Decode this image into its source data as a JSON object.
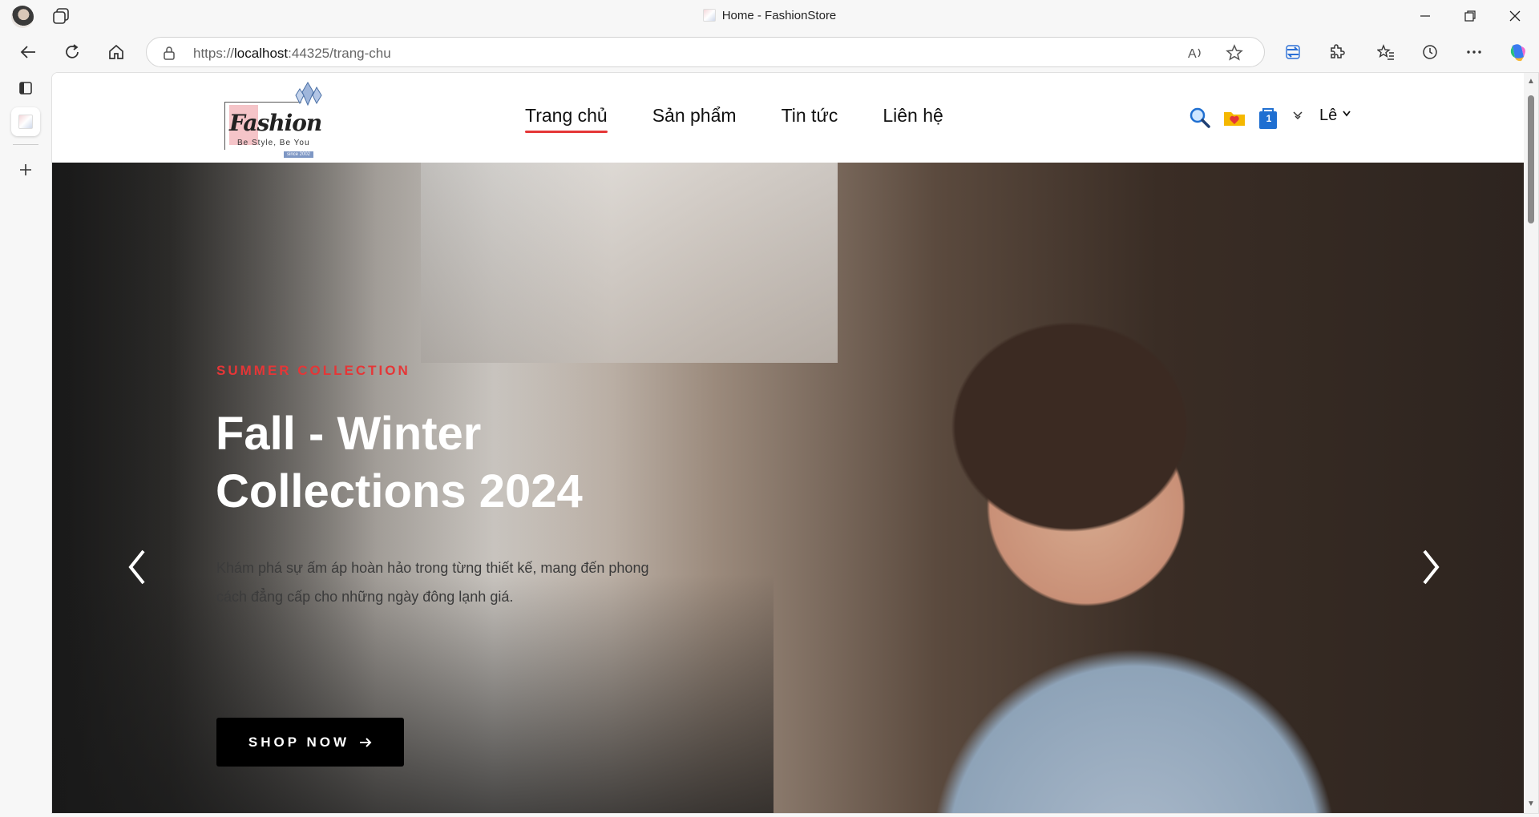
{
  "browser": {
    "window_title": "Home - FashionStore",
    "url_scheme": "https://",
    "url_host": "localhost",
    "url_rest": ":44325/trang-chu"
  },
  "site": {
    "logo": {
      "brand": "Fashion",
      "tagline": "Be Style, Be You",
      "since": "since 2002"
    },
    "nav": [
      {
        "label": "Trang chủ",
        "active": true
      },
      {
        "label": "Sản phẩm",
        "active": false
      },
      {
        "label": "Tin tức",
        "active": false
      },
      {
        "label": "Liên hệ",
        "active": false
      }
    ],
    "cart_count": "1",
    "user_name": "Lê"
  },
  "hero": {
    "kicker": "SUMMER COLLECTION",
    "title": "Fall - Winter Collections 2024",
    "description": "Khám phá sự ấm áp hoàn hảo trong từng thiết kế, mang đến phong cách đẳng cấp cho những ngày đông lạnh giá.",
    "cta_label": "SHOP NOW"
  },
  "colors": {
    "accent": "#e53637",
    "cta_bg": "#000000"
  }
}
